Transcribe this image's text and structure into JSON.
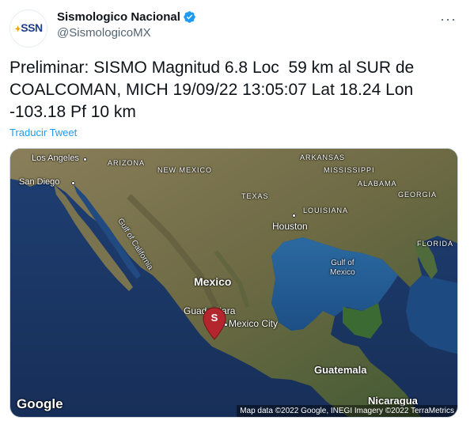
{
  "account": {
    "display_name": "Sismologico Nacional",
    "handle": "@SismologicoMX",
    "avatar_text": "SSN",
    "avatar_subtext": "SERVICIO SISMOLÓGICO NACIONAL",
    "verified_icon": "verified-badge-icon"
  },
  "more_icon": "···",
  "tweet": {
    "text": "Preliminar: SISMO Magnitud 6.8 Loc  59 km al SUR de COALCOMAN, MICH 19/09/22 13:05:07 Lat 18.24 Lon -103.18 Pf 10 km",
    "translate_label": "Traducir Tweet"
  },
  "map": {
    "labels": {
      "los_angeles": "Los Angeles",
      "san_diego": "San Diego",
      "arizona": "ARIZONA",
      "new_mexico": "NEW MEXICO",
      "arkansas": "ARKANSAS",
      "mississippi": "MISSISSIPPI",
      "alabama": "ALABAMA",
      "georgia": "GEORGIA",
      "texas": "TEXAS",
      "louisiana": "LOUISIANA",
      "houston": "Houston",
      "florida": "FLORIDA",
      "gulf_california": "Gulf of California",
      "gulf_mexico": "Gulf of\nMexico",
      "mexico": "Mexico",
      "guadalajara": "Guadalajara",
      "mexico_city": "Mexico City",
      "guatemala": "Guatemala",
      "nicaragua": "Nicaragua"
    },
    "pin_letter": "S",
    "google_logo": "Google",
    "attribution": "Map data ©2022 Google, INEGI Imagery ©2022 TerraMetrics",
    "colors": {
      "ocean": "#1c3a6b",
      "land": "#6f6a48",
      "pin": "#b3262e",
      "link": "#1d9bf0"
    }
  }
}
